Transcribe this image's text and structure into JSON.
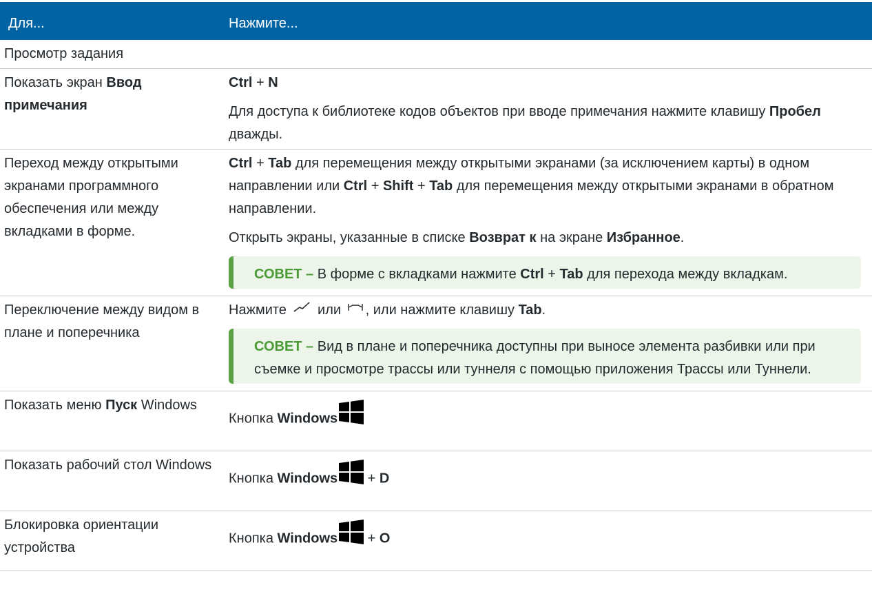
{
  "header": {
    "col1": "Для...",
    "col2": "Нажмите..."
  },
  "section_title": "Просмотр задания",
  "rows": [
    {
      "left_pre": "Показать экран ",
      "left_bold": "Ввод примечания",
      "r1_key1": "Ctrl",
      "r1_plus": " + ",
      "r1_key2": "N",
      "r2_pre": "Для доступа к библиотеке кодов объектов при вводе примечания нажмите клавишу ",
      "r2_key": "Пробел",
      "r2_post": " дважды."
    },
    {
      "left": "Переход между открытыми экранами программного обеспечения или между вкладками в форме.",
      "p1_k1": "Ctrl",
      "p1_plus1": " + ",
      "p1_k2": "Tab",
      "p1_mid": " для перемещения между открытыми экранами (за исключением карты) в одном направлении или ",
      "p1_k3": "Ctrl",
      "p1_plus2": " + ",
      "p1_k4": "Shift",
      "p1_plus3": " + ",
      "p1_k5": "Tab",
      "p1_end": " для перемещения между открытыми экранами в обратном направлении.",
      "p2_pre": "Открыть экраны, указанные в списке ",
      "p2_b1": "Возврат к",
      "p2_mid": " на экране ",
      "p2_b2": "Избранное",
      "p2_end": ".",
      "tip_label": "СОВЕТ –",
      "tip_pre": " В форме с вкладками нажмите ",
      "tip_k1": "Ctrl",
      "tip_plus": " + ",
      "tip_k2": "Tab",
      "tip_end": " для перехода между вкладкам."
    },
    {
      "left": "Переключение между видом в плане и поперечника",
      "p1_pre": "Нажмите ",
      "p1_or": " или ",
      "p1_mid": ", или нажмите клавишу ",
      "p1_key": "Tab",
      "p1_end": ".",
      "icon1": "plan-view-icon",
      "icon2": "cross-section-icon",
      "tip_label": "СОВЕТ –",
      "tip_text": " Вид в плане и поперечника доступны при выносе элемента разбивки или при съемке и просмотре трассы или туннеля с помощью приложения Трассы или Туннели."
    },
    {
      "left_pre": "Показать меню ",
      "left_bold": "Пуск",
      "left_post": " Windows",
      "right_pre": "Кнопка ",
      "right_key": "Windows",
      "icon": "windows-logo-icon"
    },
    {
      "left": "Показать рабочий стол Windows",
      "right_pre": "Кнопка ",
      "right_key": "Windows",
      "right_plus": " + ",
      "right_key2": "D",
      "icon": "windows-logo-icon"
    },
    {
      "left": "Блокировка ориентации устройства",
      "right_pre": "Кнопка ",
      "right_key": "Windows",
      "right_plus": " + ",
      "right_key2": "O",
      "icon": "windows-logo-icon"
    }
  ],
  "colors": {
    "header_bg": "#0063a3",
    "tip_bg": "#edf4e9",
    "tip_border": "#5aa145",
    "tip_label": "#4a9a36"
  }
}
